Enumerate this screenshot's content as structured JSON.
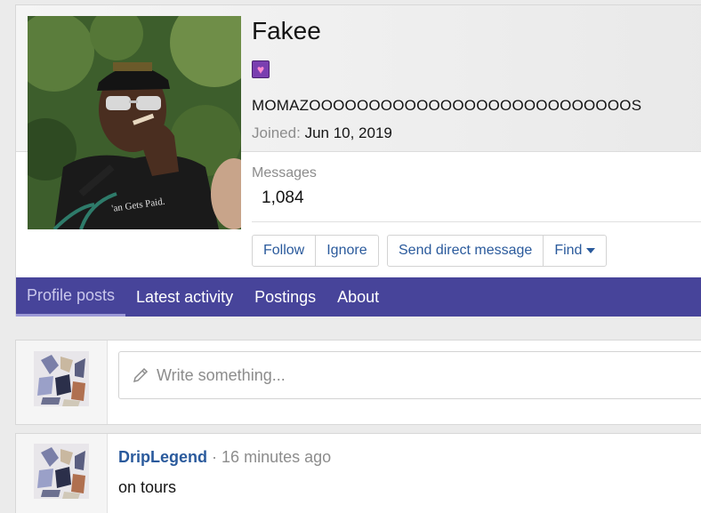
{
  "profile": {
    "username": "Fakee",
    "status": "MOMAZOOOOOOOOOOOOOOOOOOOOOOOOOOOS",
    "joined_label": "Joined:",
    "joined_date": "Jun 10, 2019",
    "avatar_caption": "'an Gets Paid.",
    "badge_icon": "heart-badge-icon",
    "stats": {
      "messages_label": "Messages",
      "messages_value": "1,084"
    },
    "buttons": {
      "follow": "Follow",
      "ignore": "Ignore",
      "message": "Send direct message",
      "find": "Find"
    }
  },
  "tabs": [
    {
      "label": "Profile posts",
      "active": true
    },
    {
      "label": "Latest activity"
    },
    {
      "label": "Postings"
    },
    {
      "label": "About"
    }
  ],
  "composer": {
    "placeholder": "Write something..."
  },
  "post": {
    "author": "DripLegend",
    "separator": "·",
    "time": "16 minutes ago",
    "body": "on tours"
  },
  "colors": {
    "tab_bar": "#47449a",
    "link": "#2a5a9c",
    "muted": "#8c8c8c"
  }
}
